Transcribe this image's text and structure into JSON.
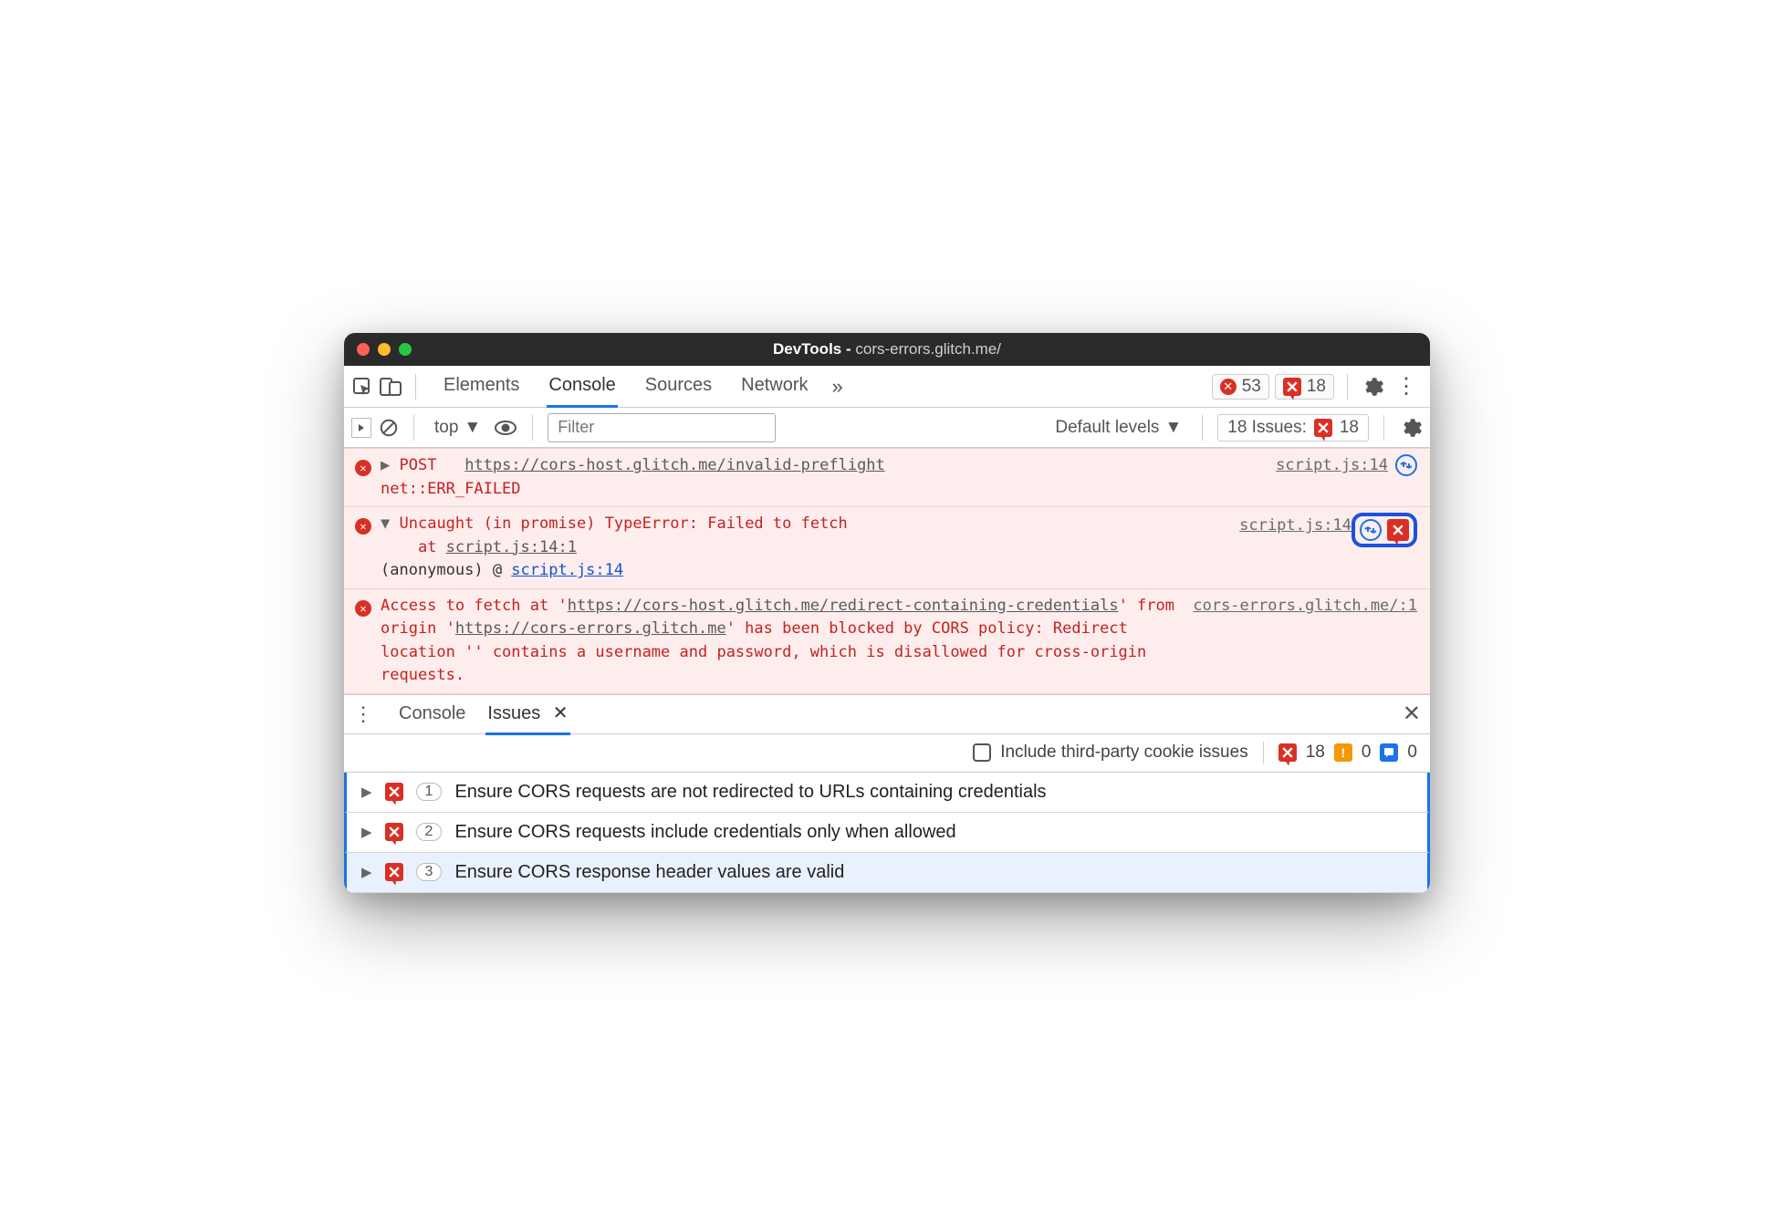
{
  "window": {
    "title_prefix": "DevTools - ",
    "title_url": "cors-errors.glitch.me/"
  },
  "tabs": {
    "items": [
      "Elements",
      "Console",
      "Sources",
      "Network"
    ],
    "active": "Console",
    "overflow": "»",
    "error_count": "53",
    "issue_count": "18"
  },
  "subtoolbar": {
    "context": "top",
    "filter_placeholder": "Filter",
    "levels": "Default levels",
    "issues_label": "18 Issues:",
    "issues_count": "18"
  },
  "console": {
    "entries": [
      {
        "kind": "error",
        "expand": "▶",
        "method": "POST",
        "url": "https://cors-host.glitch.me/invalid-preflight",
        "status": "net::ERR_FAILED",
        "source": "script.js:14",
        "has_net_icon": true
      },
      {
        "kind": "error",
        "expand": "▼",
        "msg": "Uncaught (in promise) TypeError: Failed to fetch",
        "stack_at": "at ",
        "stack_link": "script.js:14:1",
        "anon_prefix": "(anonymous) @ ",
        "anon_link": "script.js:14",
        "source": "script.js:14",
        "has_callout": true
      },
      {
        "kind": "error",
        "text_pre": "Access to fetch at '",
        "url1": "https://cors-host.glitch.me/redirect-containing-credentials",
        "text_mid1": "' from origin '",
        "url2": "https://cors-errors.glitch.me",
        "text_post": "' has been blocked by CORS policy: Redirect location '' contains a username and password, which is disallowed for cross-origin requests.",
        "source": "cors-errors.glitch.me/:1"
      }
    ]
  },
  "drawer": {
    "tabs": [
      "Console",
      "Issues"
    ],
    "active": "Issues",
    "include_label": "Include third-party cookie issues",
    "counts": {
      "error": "18",
      "warn": "0",
      "info": "0"
    },
    "items": [
      {
        "count": "1",
        "text": "Ensure CORS requests are not redirected to URLs containing credentials"
      },
      {
        "count": "2",
        "text": "Ensure CORS requests include credentials only when allowed"
      },
      {
        "count": "3",
        "text": "Ensure CORS response header values are valid"
      }
    ]
  }
}
